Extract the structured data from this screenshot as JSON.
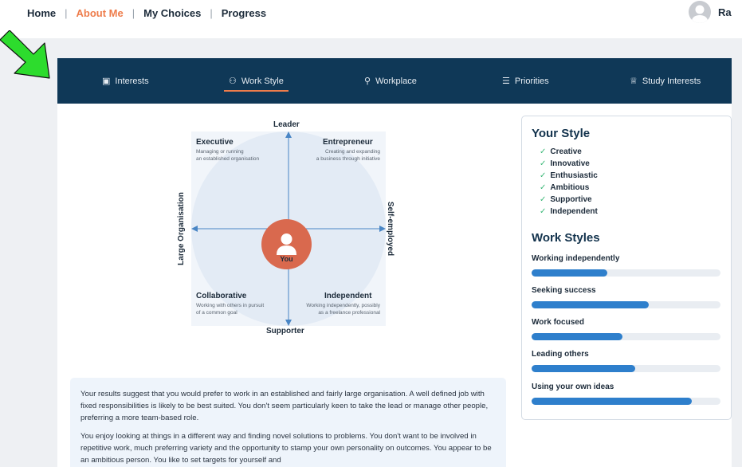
{
  "topnav": {
    "items": [
      {
        "label": "Home",
        "active": false
      },
      {
        "label": "About Me",
        "active": true
      },
      {
        "label": "My Choices",
        "active": false
      },
      {
        "label": "Progress",
        "active": false
      }
    ],
    "separator": "|",
    "user_name": "Ra"
  },
  "tabs": [
    {
      "label": "Interests",
      "icon": "id-card-icon",
      "glyph": "▣",
      "active": false
    },
    {
      "label": "Work Style",
      "icon": "users-icon",
      "glyph": "⚇",
      "active": true
    },
    {
      "label": "Workplace",
      "icon": "user-icon",
      "glyph": "⚲",
      "active": false
    },
    {
      "label": "Priorities",
      "icon": "list-icon",
      "glyph": "☰",
      "active": false
    },
    {
      "label": "Study Interests",
      "icon": "graduation-icon",
      "glyph": "♕",
      "active": false
    }
  ],
  "quadrant": {
    "axis_top": "Leader",
    "axis_bottom": "Supporter",
    "axis_left": "Large Organisation",
    "axis_right": "Self-employed",
    "center_label": "You",
    "quadrants": {
      "top_left": {
        "title": "Executive",
        "desc_line1": "Managing or running",
        "desc_line2": "an established organisation"
      },
      "top_right": {
        "title": "Entrepreneur",
        "desc_line1": "Creating and expanding",
        "desc_line2": "a business through initiative"
      },
      "bottom_left": {
        "title": "Collaborative",
        "desc_line1": "Working with others in pursuit",
        "desc_line2": "of a common goal"
      },
      "bottom_right": {
        "title": "Independent",
        "desc_line1": "Working independently, possibly",
        "desc_line2": "as a freelance professional"
      }
    },
    "colors": {
      "circle": "#e3ebf5",
      "square": "#f1f5fa",
      "you": "#d9694e",
      "axis": "#4a86c5"
    }
  },
  "your_style": {
    "title": "Your Style",
    "traits": [
      "Creative",
      "Innovative",
      "Enthusiastic",
      "Ambitious",
      "Supportive",
      "Independent"
    ]
  },
  "work_styles": {
    "title": "Work Styles",
    "items": [
      {
        "label": "Working independently",
        "value": 0.4
      },
      {
        "label": "Seeking success",
        "value": 0.62
      },
      {
        "label": "Work focused",
        "value": 0.48
      },
      {
        "label": "Leading others",
        "value": 0.55
      },
      {
        "label": "Using your own ideas",
        "value": 0.85
      }
    ]
  },
  "summary": {
    "para1": "Your results suggest that you would prefer to work in an established and fairly large organisation.  A well defined job with fixed responsibilities is likely to be best suited.  You don't seem particularly keen to take the lead or manage other people, preferring a more team-based role.",
    "para2": "You enjoy looking at things in a different way and finding novel solutions to problems. You don't want to be involved in repetitive work, much preferring variety and the opportunity to stamp your own personality on outcomes. You appear to be an ambitious person. You like to set targets for yourself and"
  },
  "colors": {
    "navy": "#0f3857",
    "accent": "#ee7c4b",
    "bar": "#2e7fcc",
    "check": "#3cb878",
    "pointer_arrow": "#2ddc2d"
  }
}
